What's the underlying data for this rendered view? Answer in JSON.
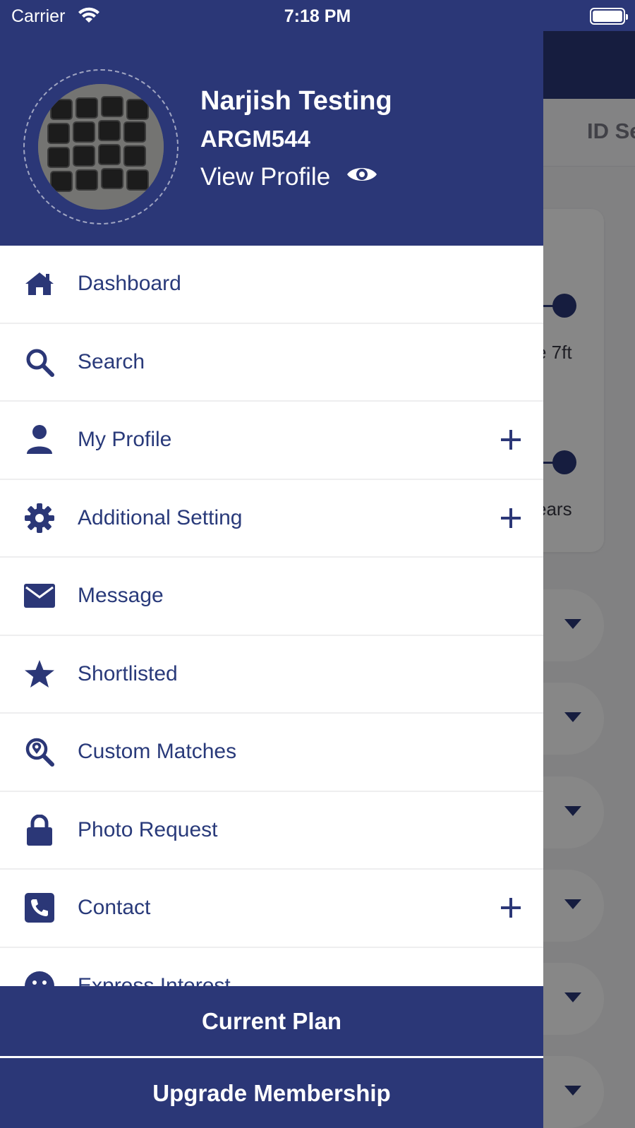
{
  "status_bar": {
    "carrier": "Carrier",
    "time": "7:18 PM"
  },
  "background": {
    "tab_label": "ID Se",
    "slider_1_label": "e 7ft",
    "slider_2_label": "ears"
  },
  "profile": {
    "name": "Narjish Testing",
    "id": "ARGM544",
    "view_profile_label": "View Profile"
  },
  "menu": {
    "items": [
      {
        "label": "Dashboard",
        "icon": "home-icon",
        "expandable": false
      },
      {
        "label": "Search",
        "icon": "search-icon",
        "expandable": false
      },
      {
        "label": "My Profile",
        "icon": "user-icon",
        "expandable": true
      },
      {
        "label": "Additional Setting",
        "icon": "gear-icon",
        "expandable": true
      },
      {
        "label": "Message",
        "icon": "envelope-icon",
        "expandable": false
      },
      {
        "label": "Shortlisted",
        "icon": "star-icon",
        "expandable": false
      },
      {
        "label": "Custom Matches",
        "icon": "search-location-icon",
        "expandable": false
      },
      {
        "label": "Photo Request",
        "icon": "lock-icon",
        "expandable": false
      },
      {
        "label": "Contact",
        "icon": "phone-square-icon",
        "expandable": true
      },
      {
        "label": "Express Interest",
        "icon": "smile-icon",
        "expandable": false
      }
    ]
  },
  "buttons": {
    "current_plan": "Current Plan",
    "upgrade_membership": "Upgrade Membership"
  },
  "colors": {
    "primary": "#2b3777",
    "text": "#293a7a",
    "background": "#ffffff"
  }
}
